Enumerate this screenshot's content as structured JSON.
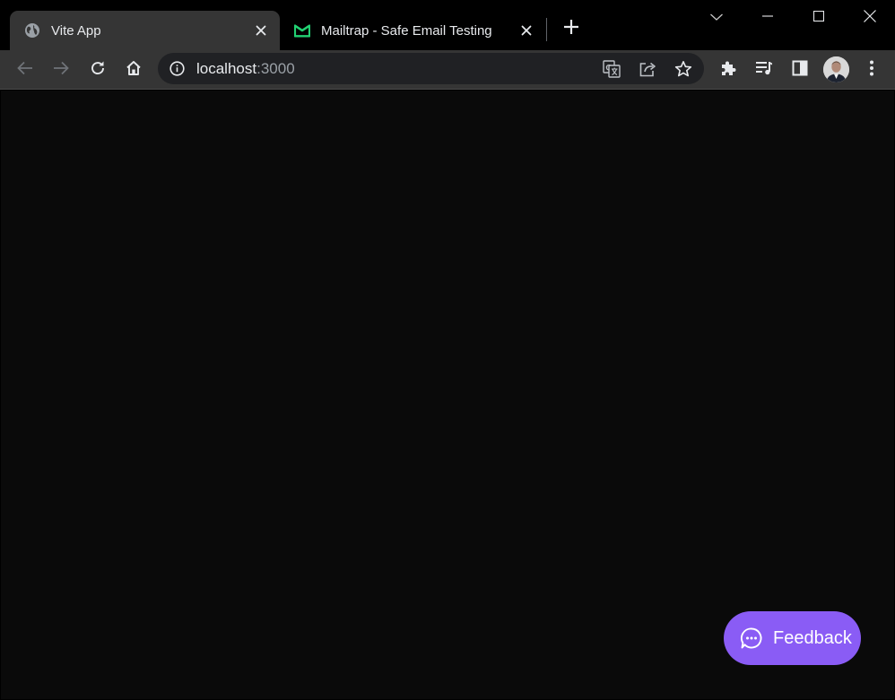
{
  "tabs": [
    {
      "title": "Vite App",
      "favicon": "globe-icon",
      "active": true
    },
    {
      "title": "Mailtrap - Safe Email Testing",
      "favicon": "mailtrap-logo-icon",
      "active": false
    }
  ],
  "omnibox": {
    "host": "localhost",
    "port": ":3000"
  },
  "page": {
    "feedback_label": "Feedback"
  },
  "colors": {
    "accent": "#8a5cf5",
    "mailtrap_green": "#22d172",
    "page_background": "#0a0a0a",
    "toolbar_background": "#353535"
  },
  "icons": {
    "tab_close": "close-icon",
    "new_tab": "plus-icon",
    "tab_search": "chevron-down-icon",
    "back": "arrow-left-icon",
    "forward": "arrow-right-icon",
    "reload": "reload-icon",
    "home": "home-icon",
    "site_info": "info-icon",
    "translate": "translate-icon",
    "share": "share-icon",
    "bookmark": "star-icon",
    "extensions": "puzzle-icon",
    "media": "playlist-icon",
    "side_panel": "side-panel-icon",
    "menu": "kebab-menu-icon",
    "feedback": "chat-bubble-icon"
  }
}
